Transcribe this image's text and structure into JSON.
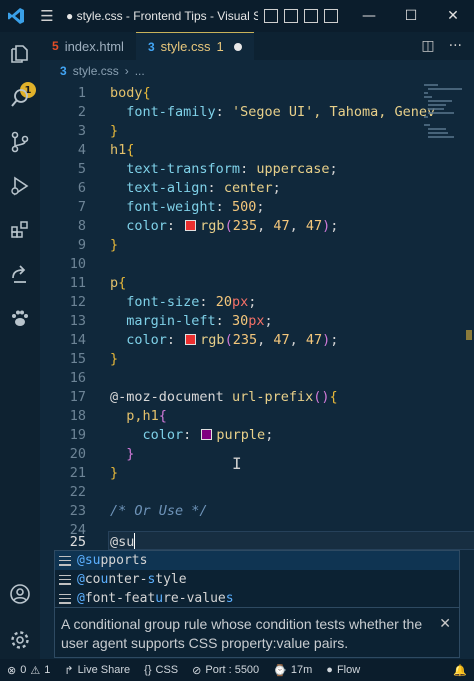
{
  "titlebar": {
    "title": "● style.css - Frontend Tips - Visual S",
    "window_controls": [
      "minimize",
      "maximize",
      "close"
    ]
  },
  "activity": {
    "badge": "1",
    "items": [
      "explorer",
      "search",
      "source-control",
      "run-debug",
      "extensions",
      "live-share",
      "paw",
      "accounts",
      "settings"
    ]
  },
  "tabs": [
    {
      "label": "index.html",
      "icon": "5"
    },
    {
      "label": "style.css",
      "icon": "3",
      "modified_count": "1"
    }
  ],
  "breadcrumb": {
    "file": "style.css",
    "more": "..."
  },
  "editor": {
    "current_line": 25,
    "lines": [
      {
        "n": "1"
      },
      {
        "n": "2"
      },
      {
        "n": "3"
      },
      {
        "n": "4"
      },
      {
        "n": "5"
      },
      {
        "n": "6"
      },
      {
        "n": "7"
      },
      {
        "n": "8"
      },
      {
        "n": "9"
      },
      {
        "n": "10"
      },
      {
        "n": "11"
      },
      {
        "n": "12"
      },
      {
        "n": "13"
      },
      {
        "n": "14"
      },
      {
        "n": "15"
      },
      {
        "n": "16"
      },
      {
        "n": "17"
      },
      {
        "n": "18"
      },
      {
        "n": "19"
      },
      {
        "n": "20"
      },
      {
        "n": "21"
      },
      {
        "n": "22"
      },
      {
        "n": "23"
      },
      {
        "n": "24"
      },
      {
        "n": "25"
      }
    ],
    "t": {
      "body": "body",
      "font_family": "font-family",
      "font_family_val": "'Segoe UI', Tahoma, Genev",
      "h1": "h1",
      "text_transform": "text-transform",
      "uppercase": "uppercase",
      "text_align": "text-align",
      "center": "center",
      "font_weight": "font-weight",
      "w500": "500",
      "color": "color",
      "rgb": "rgb",
      "n235": "235",
      "n47": "47",
      "n47b": "47",
      "p": "p",
      "font_size": "font-size",
      "n20": "20",
      "px": "px",
      "margin_left": "margin-left",
      "n30": "30",
      "at_moz": "@-moz-document",
      "url_prefix": "url-prefix",
      "ph1": "p,h1",
      "purple": "purple",
      "comment": "/* Or Use */",
      "typed": "@su"
    },
    "colors": {
      "red": "#eb2f2f",
      "purple": "#800080"
    }
  },
  "suggest": {
    "items": [
      {
        "match": "@su",
        "rest": "pports"
      },
      {
        "a": "@",
        "b": "c",
        "c": "o",
        "d": "u",
        "e": "nter-",
        "f": "s",
        "g": "tyle"
      },
      {
        "a": "@",
        "b": "font-feat",
        "c": "u",
        "d": "re-value",
        "e": "s"
      }
    ],
    "details": "A conditional group rule whose condition tests whether the user agent supports CSS property:value pairs.",
    "close": "✕"
  },
  "statusbar": {
    "remote": "⊗ 0 ⚠ 1",
    "errors": "0",
    "warnings": "1",
    "live_share": "Live Share",
    "language": "CSS",
    "port": "Port : 5500",
    "time": "17m",
    "flow": "Flow",
    "bell": "bell"
  }
}
